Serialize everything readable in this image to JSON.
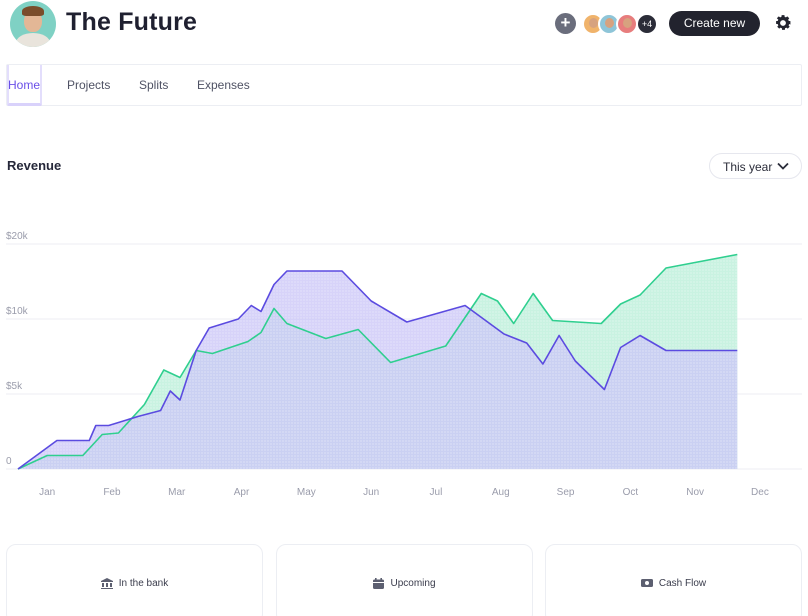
{
  "header": {
    "title": "The Future",
    "more_members": "+4",
    "create_label": "Create new"
  },
  "tabs": [
    {
      "label": "Home",
      "active": true
    },
    {
      "label": "Projects",
      "active": false
    },
    {
      "label": "Splits",
      "active": false
    },
    {
      "label": "Expenses",
      "active": false
    }
  ],
  "revenue": {
    "title": "Revenue",
    "period": "This year"
  },
  "chart_data": {
    "type": "area",
    "ylim": [
      0,
      20000
    ],
    "yticks": [
      "0",
      "$5k",
      "$10k",
      "$20k"
    ],
    "categories": [
      "Jan",
      "Feb",
      "Mar",
      "Apr",
      "May",
      "Jun",
      "Jul",
      "Aug",
      "Sep",
      "Oct",
      "Nov",
      "Dec"
    ],
    "grid": true,
    "series": [
      {
        "color": "#5b4be0",
        "fill": "#c9c4f7",
        "points": [
          [
            0.0,
            0
          ],
          [
            0.6,
            1900
          ],
          [
            1.1,
            1900
          ],
          [
            1.2,
            2900
          ],
          [
            1.4,
            2900
          ],
          [
            1.85,
            3500
          ],
          [
            2.2,
            3900
          ],
          [
            2.35,
            5200
          ],
          [
            2.5,
            4600
          ],
          [
            2.75,
            7900
          ],
          [
            2.95,
            9400
          ],
          [
            3.4,
            10000
          ],
          [
            3.6,
            10900
          ],
          [
            3.75,
            10500
          ],
          [
            3.95,
            12300
          ],
          [
            4.15,
            13200
          ],
          [
            5.0,
            13200
          ],
          [
            5.45,
            11200
          ],
          [
            6.0,
            9800
          ],
          [
            6.9,
            10900
          ],
          [
            7.5,
            9000
          ],
          [
            7.85,
            8400
          ],
          [
            8.1,
            7000
          ],
          [
            8.35,
            8900
          ],
          [
            8.6,
            7200
          ],
          [
            9.05,
            5300
          ],
          [
            9.3,
            8100
          ],
          [
            9.6,
            8900
          ],
          [
            10.0,
            7900
          ],
          [
            11.1,
            7900
          ]
        ]
      },
      {
        "color": "#2fcf8f",
        "fill": "#bff0dc",
        "points": [
          [
            0.0,
            0
          ],
          [
            0.45,
            900
          ],
          [
            1.0,
            900
          ],
          [
            1.3,
            2300
          ],
          [
            1.55,
            2400
          ],
          [
            1.95,
            4300
          ],
          [
            2.25,
            6600
          ],
          [
            2.5,
            6100
          ],
          [
            2.75,
            7900
          ],
          [
            3.0,
            7700
          ],
          [
            3.55,
            8500
          ],
          [
            3.75,
            9100
          ],
          [
            3.95,
            10700
          ],
          [
            4.15,
            9700
          ],
          [
            4.75,
            8700
          ],
          [
            5.25,
            9300
          ],
          [
            5.75,
            7100
          ],
          [
            6.6,
            8200
          ],
          [
            7.15,
            11700
          ],
          [
            7.4,
            11200
          ],
          [
            7.65,
            9700
          ],
          [
            7.95,
            11700
          ],
          [
            8.25,
            9900
          ],
          [
            9.0,
            9700
          ],
          [
            9.3,
            11000
          ],
          [
            9.6,
            11600
          ],
          [
            10.0,
            13400
          ],
          [
            11.1,
            14300
          ]
        ]
      }
    ]
  },
  "cards": [
    {
      "label": "In the bank",
      "icon": "bank-icon"
    },
    {
      "label": "Upcoming",
      "icon": "calendar-icon"
    },
    {
      "label": "Cash Flow",
      "icon": "cash-icon"
    }
  ]
}
